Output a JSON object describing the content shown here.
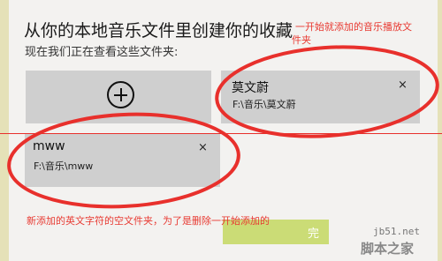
{
  "dialog": {
    "title": "从你的本地音乐文件里创建你的收藏",
    "subtitle": "现在我们正在查看这些文件夹:",
    "add_folder_icon": "plus-circle-icon",
    "ok_button_label": "完"
  },
  "folders": [
    {
      "name": "莫文蔚",
      "path": "F:\\音乐\\莫文蔚",
      "remove_icon": "close-icon",
      "remove_glyph": "×"
    },
    {
      "name": "mww",
      "path": "F:\\音乐\\mww",
      "remove_icon": "close-icon",
      "remove_glyph": "×"
    }
  ],
  "annotations": {
    "top_note_line1": "一开始就添加的音乐播放文",
    "top_note_line2": "件夹",
    "bottom_note": "新添加的英文字符的空文件夹，为了是删除一开始添加的"
  },
  "watermark": {
    "site": "jb51.net",
    "brand": "脚本之家"
  },
  "colors": {
    "tile": "#cfcfcf",
    "annotation_red": "#e83a32",
    "button_green": "#cbdc76"
  }
}
